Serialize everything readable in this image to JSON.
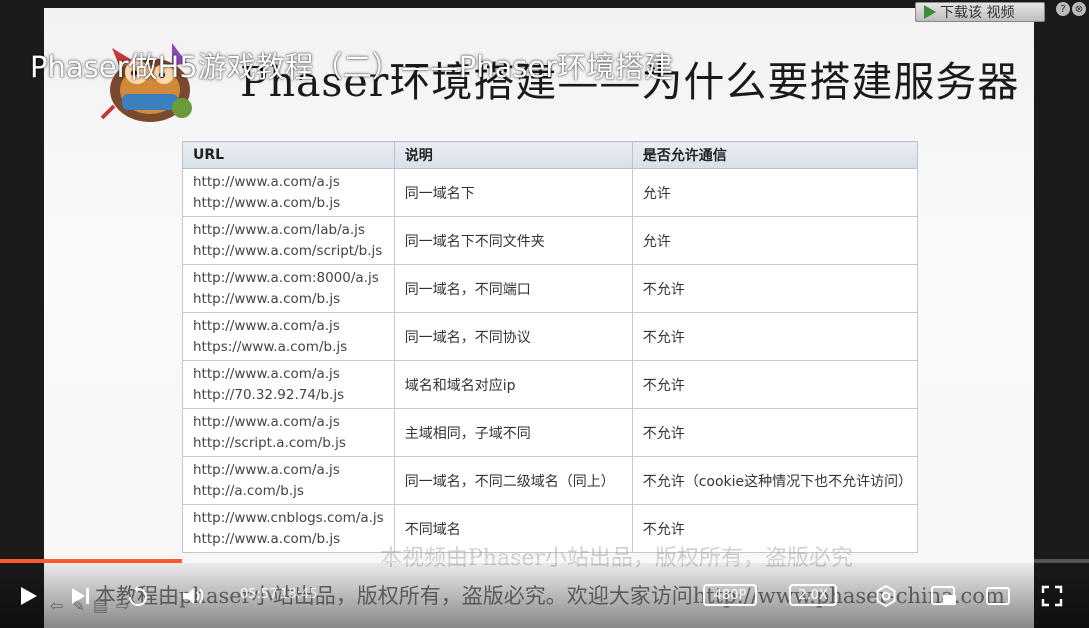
{
  "player": {
    "video_title": "Phaser做H5游戏教程（二）——Phaser环境搭建",
    "current_time": "05:57",
    "duration": "18:45",
    "progress_fraction": 0.167,
    "quality_label": "480P",
    "speed_label": "2.0X",
    "download_label": "下载该 视频",
    "accent_color": "#ff5a2d"
  },
  "slide": {
    "title": "Phaser环境搭建——为什么要搭建服务器",
    "table": {
      "headers": [
        "URL",
        "说明",
        "是否允许通信"
      ],
      "rows": [
        {
          "url1": "http://www.a.com/a.js",
          "url2": "http://www.a.com/b.js",
          "desc": "同一域名下",
          "allow": "允许"
        },
        {
          "url1": "http://www.a.com/lab/a.js",
          "url2": "http://www.a.com/script/b.js",
          "desc": "同一域名下不同文件夹",
          "allow": "允许"
        },
        {
          "url1": "http://www.a.com:8000/a.js",
          "url2": "http://www.a.com/b.js",
          "desc": "同一域名，不同端口",
          "allow": "不允许"
        },
        {
          "url1": "http://www.a.com/a.js",
          "url2": "https://www.a.com/b.js",
          "desc": "同一域名，不同协议",
          "allow": "不允许"
        },
        {
          "url1": "http://www.a.com/a.js",
          "url2": "http://70.32.92.74/b.js",
          "desc": "域名和域名对应ip",
          "allow": "不允许"
        },
        {
          "url1": "http://www.a.com/a.js",
          "url2": "http://script.a.com/b.js",
          "desc": "主域相同，子域不同",
          "allow": "不允许"
        },
        {
          "url1": "http://www.a.com/a.js",
          "url2": "http://a.com/b.js",
          "desc": "同一域名，不同二级域名（同上）",
          "allow": "不允许（cookie这种情况下也不允许访问）"
        },
        {
          "url1": "http://www.cnblogs.com/a.js",
          "url2": "http://www.a.com/b.js",
          "desc": "不同域名",
          "allow": "不允许"
        }
      ]
    },
    "watermark": "本视频由Phaser小站出品，版权所有，盗版必究",
    "subtitle": "本教程由phaser小站出品，版权所有，盗版必究。欢迎大家访问http://www.phaser-china.com"
  },
  "icons": {
    "play": "play-icon",
    "next": "next-icon",
    "replay": "replay-icon",
    "volume": "volume-icon",
    "settings": "settings-icon",
    "pip": "picture-in-picture-icon",
    "widescreen": "widescreen-icon",
    "fullscreen": "fullscreen-icon"
  }
}
